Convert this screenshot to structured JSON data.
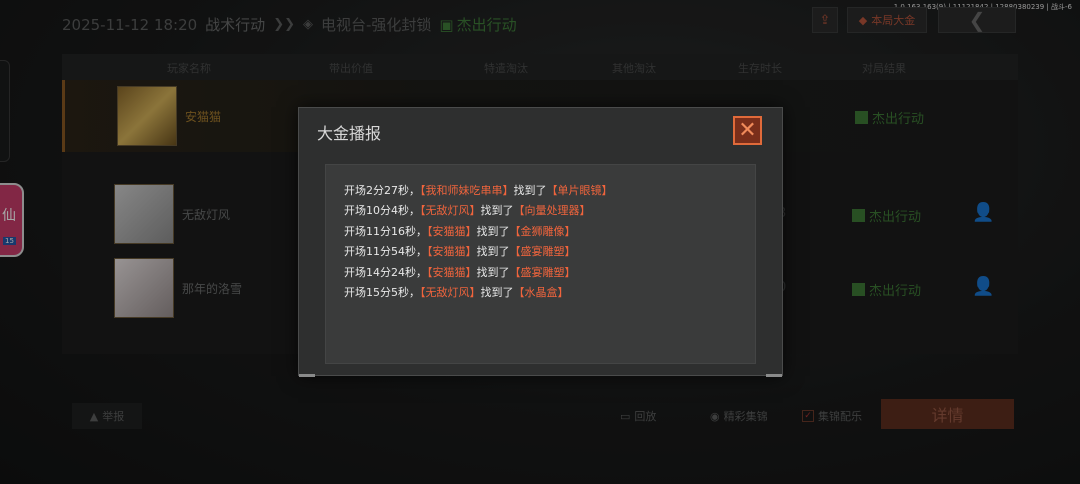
{
  "version_text": "1.0.163.163(9) | 11121842 | 12880380239 | 战斗-6",
  "header": {
    "datetime": "2025-11-12 18:20",
    "mode": "战术行动",
    "map": "电视台-强化封锁",
    "result": "杰出行动"
  },
  "toolbar": {
    "mvp_label": "本局大金",
    "back_icon": "chevron-left-icon",
    "share_icon": "share-icon"
  },
  "table": {
    "columns": [
      "玩家名称",
      "带出价值",
      "特遣淘汰",
      "其他淘汰",
      "生存时长",
      "对局结果"
    ],
    "rows": [
      {
        "name": "安猫猫",
        "result": "杰出行动",
        "partial_value": "",
        "highlight": true
      },
      {
        "name": "无敌灯风",
        "result": "杰出行动",
        "partial_value": "3",
        "highlight": false
      },
      {
        "name": "那年的洛雪",
        "result": "杰出行动",
        "partial_value": "0",
        "highlight": false
      }
    ]
  },
  "bottom": {
    "report": "举报",
    "replay": "回放",
    "highlights": "精彩集锦",
    "music": "集锦配乐",
    "detail": "详情"
  },
  "side_app": {
    "glyph": "仙",
    "badge": "15"
  },
  "modal": {
    "title": "大金播报",
    "close_icon": "close-icon",
    "entries": [
      {
        "time": "开场2分27秒，",
        "player": "【我和师妹吃串串】",
        "verb": "找到了",
        "item": "【单片眼镜】"
      },
      {
        "time": "开场10分4秒，",
        "player": "【无敌灯风】",
        "verb": "找到了",
        "item": "【向量处理器】"
      },
      {
        "time": "开场11分16秒，",
        "player": "【安猫猫】",
        "verb": "找到了",
        "item": "【金狮雕像】"
      },
      {
        "time": "开场11分54秒，",
        "player": "【安猫猫】",
        "verb": "找到了",
        "item": "【盛宴雕塑】"
      },
      {
        "time": "开场14分24秒，",
        "player": "【安猫猫】",
        "verb": "找到了",
        "item": "【盛宴雕塑】"
      },
      {
        "time": "开场15分5秒，",
        "player": "【无敌灯风】",
        "verb": "找到了",
        "item": "【水晶盒】"
      }
    ]
  },
  "colors": {
    "accent_orange": "#f0643c",
    "success_green": "#3e7a37",
    "modal_bg": "#2e2f2f"
  }
}
